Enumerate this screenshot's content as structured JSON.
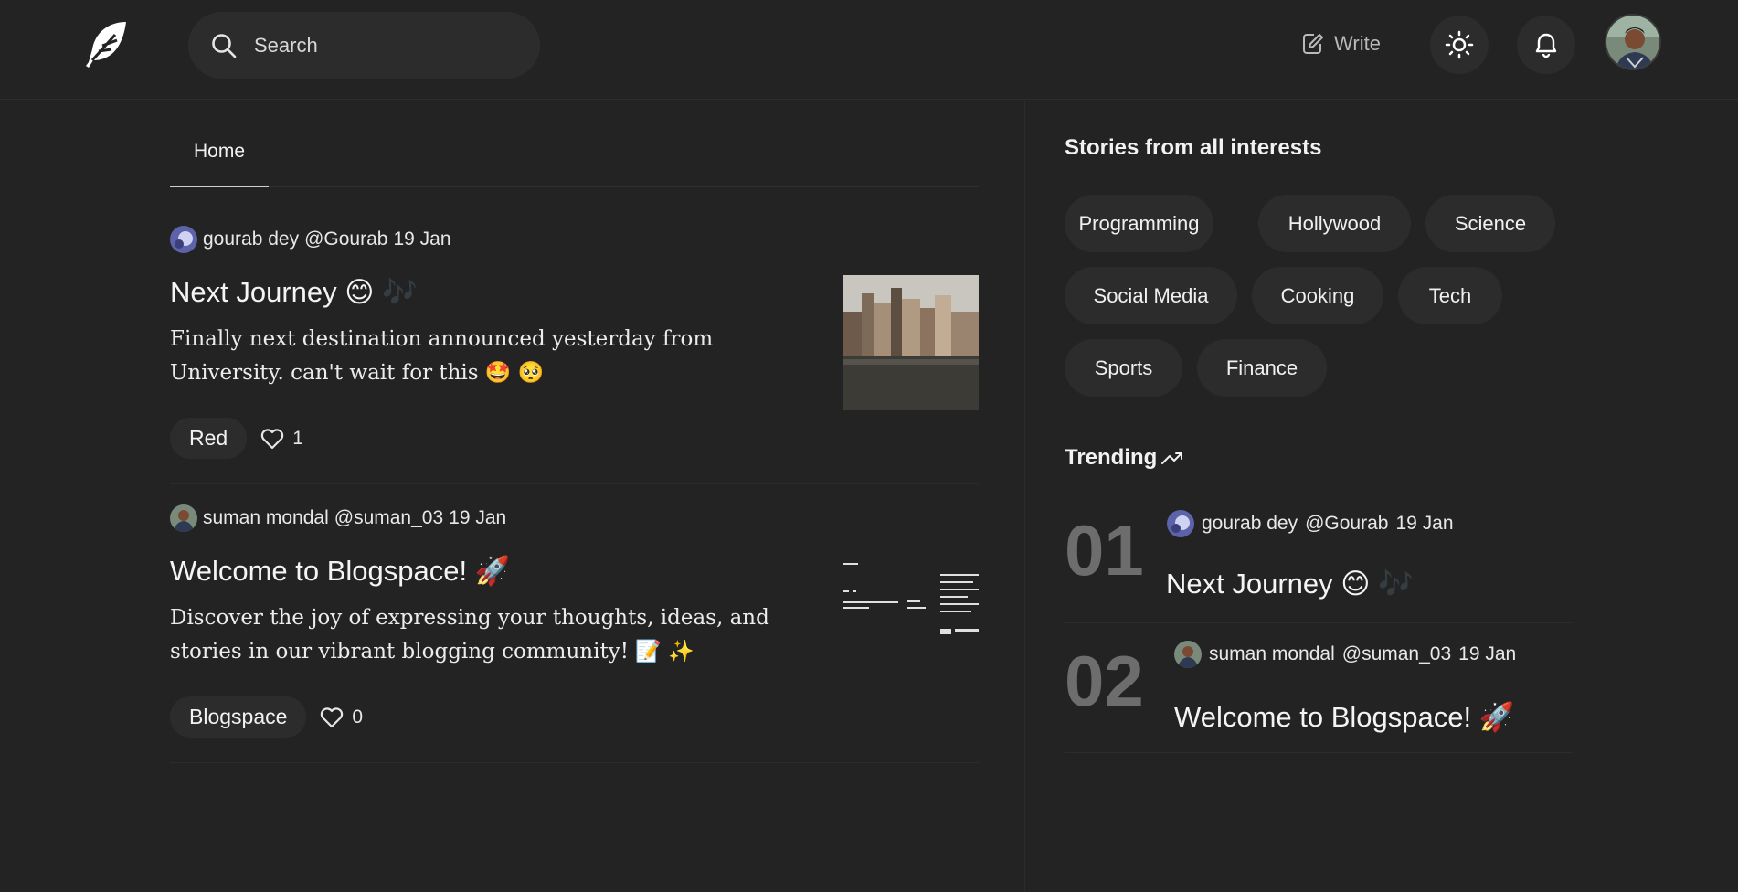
{
  "header": {
    "search_placeholder": "Search",
    "write_label": "Write"
  },
  "tabs": [
    {
      "label": "Home"
    }
  ],
  "posts": [
    {
      "author": "gourab dey",
      "handle": "@Gourab",
      "date": "19 Jan",
      "title": "Next Journey",
      "title_emoji": "😊",
      "title_emoji2": "🎶",
      "excerpt": "Finally next destination announced yesterday from University. can't wait for this",
      "excerpt_emoji": "🤩 🥺",
      "tag": "Red",
      "likes": "1"
    },
    {
      "author": "suman mondal",
      "handle": "@suman_03",
      "date": "19 Jan",
      "title": "Welcome to Blogspace!",
      "title_emoji": "🚀",
      "excerpt": "Discover the joy of expressing your thoughts, ideas, and stories in our vibrant blogging community!",
      "excerpt_emoji": "📝 ✨",
      "tag": "Blogspace",
      "likes": "0"
    }
  ],
  "interests": {
    "title": "Stories from all interests",
    "chips": [
      "Programming",
      "Hollywood",
      "Science",
      "Social Media",
      "Cooking",
      "Tech",
      "Sports",
      "Finance"
    ]
  },
  "trending": {
    "title": "Trending",
    "items": [
      {
        "rank": "01",
        "author": "gourab dey",
        "handle": "@Gourab",
        "date": "19 Jan",
        "title": "Next Journey",
        "title_emoji": "😊",
        "title_emoji2": "🎶"
      },
      {
        "rank": "02",
        "author": "suman mondal",
        "handle": "@suman_03",
        "date": "19 Jan",
        "title": "Welcome to Blogspace!",
        "title_emoji": "🚀"
      }
    ]
  },
  "colors": {
    "background": "#232323",
    "surface": "#2c2c2c",
    "muted_rank": "#6d6d6d"
  }
}
